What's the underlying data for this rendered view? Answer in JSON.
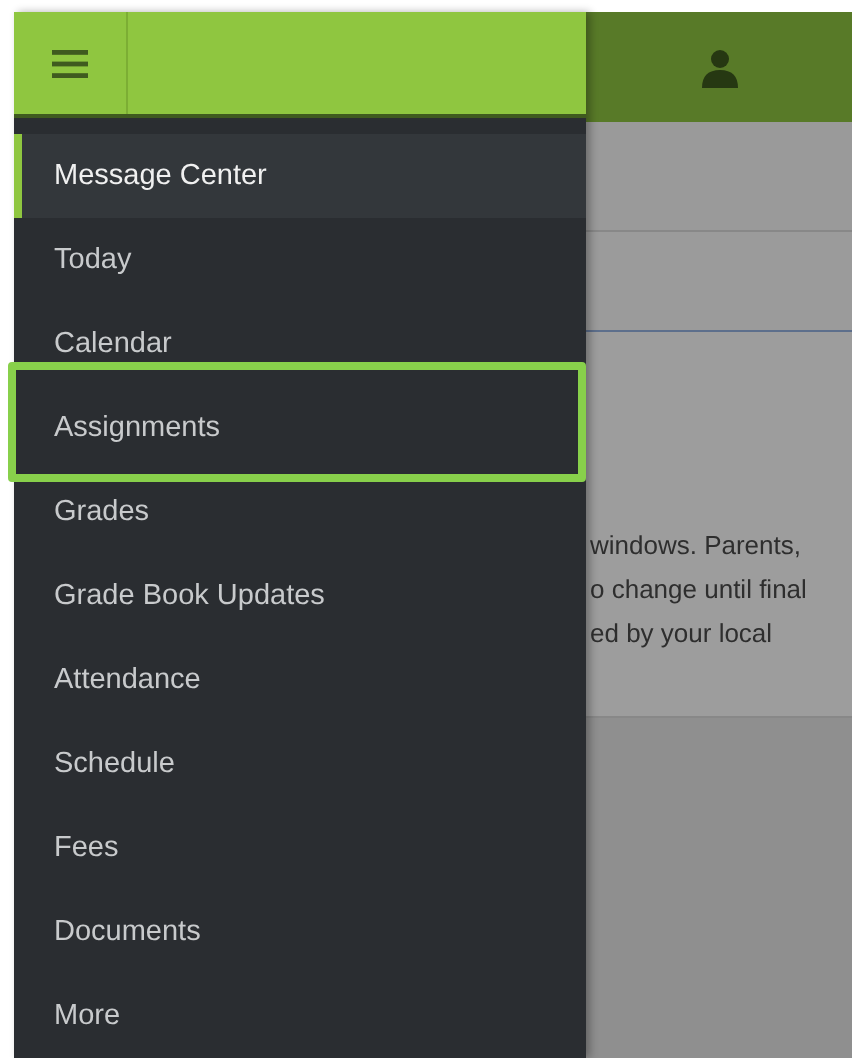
{
  "drawer": {
    "items": [
      {
        "label": "Message Center",
        "selected": true,
        "highlighted": false
      },
      {
        "label": "Today",
        "selected": false,
        "highlighted": false
      },
      {
        "label": "Calendar",
        "selected": false,
        "highlighted": false
      },
      {
        "label": "Assignments",
        "selected": false,
        "highlighted": true
      },
      {
        "label": "Grades",
        "selected": false,
        "highlighted": false
      },
      {
        "label": "Grade Book Updates",
        "selected": false,
        "highlighted": false
      },
      {
        "label": "Attendance",
        "selected": false,
        "highlighted": false
      },
      {
        "label": "Schedule",
        "selected": false,
        "highlighted": false
      },
      {
        "label": "Fees",
        "selected": false,
        "highlighted": false
      },
      {
        "label": "Documents",
        "selected": false,
        "highlighted": false
      },
      {
        "label": "More",
        "selected": false,
        "highlighted": false
      }
    ]
  },
  "content": {
    "lines": [
      "windows.  Parents,",
      "o change until final",
      "ed by your local"
    ]
  }
}
